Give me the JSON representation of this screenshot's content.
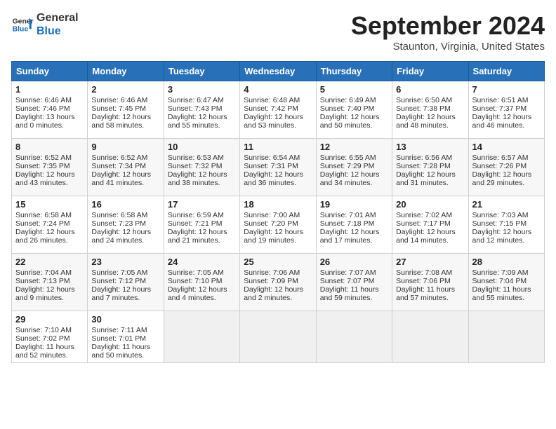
{
  "header": {
    "logo_line1": "General",
    "logo_line2": "Blue",
    "month": "September 2024",
    "location": "Staunton, Virginia, United States"
  },
  "days_of_week": [
    "Sunday",
    "Monday",
    "Tuesday",
    "Wednesday",
    "Thursday",
    "Friday",
    "Saturday"
  ],
  "weeks": [
    [
      {
        "day": "1",
        "sunrise": "Sunrise: 6:46 AM",
        "sunset": "Sunset: 7:46 PM",
        "daylight": "Daylight: 13 hours and 0 minutes."
      },
      {
        "day": "2",
        "sunrise": "Sunrise: 6:46 AM",
        "sunset": "Sunset: 7:45 PM",
        "daylight": "Daylight: 12 hours and 58 minutes."
      },
      {
        "day": "3",
        "sunrise": "Sunrise: 6:47 AM",
        "sunset": "Sunset: 7:43 PM",
        "daylight": "Daylight: 12 hours and 55 minutes."
      },
      {
        "day": "4",
        "sunrise": "Sunrise: 6:48 AM",
        "sunset": "Sunset: 7:42 PM",
        "daylight": "Daylight: 12 hours and 53 minutes."
      },
      {
        "day": "5",
        "sunrise": "Sunrise: 6:49 AM",
        "sunset": "Sunset: 7:40 PM",
        "daylight": "Daylight: 12 hours and 50 minutes."
      },
      {
        "day": "6",
        "sunrise": "Sunrise: 6:50 AM",
        "sunset": "Sunset: 7:38 PM",
        "daylight": "Daylight: 12 hours and 48 minutes."
      },
      {
        "day": "7",
        "sunrise": "Sunrise: 6:51 AM",
        "sunset": "Sunset: 7:37 PM",
        "daylight": "Daylight: 12 hours and 46 minutes."
      }
    ],
    [
      {
        "day": "8",
        "sunrise": "Sunrise: 6:52 AM",
        "sunset": "Sunset: 7:35 PM",
        "daylight": "Daylight: 12 hours and 43 minutes."
      },
      {
        "day": "9",
        "sunrise": "Sunrise: 6:52 AM",
        "sunset": "Sunset: 7:34 PM",
        "daylight": "Daylight: 12 hours and 41 minutes."
      },
      {
        "day": "10",
        "sunrise": "Sunrise: 6:53 AM",
        "sunset": "Sunset: 7:32 PM",
        "daylight": "Daylight: 12 hours and 38 minutes."
      },
      {
        "day": "11",
        "sunrise": "Sunrise: 6:54 AM",
        "sunset": "Sunset: 7:31 PM",
        "daylight": "Daylight: 12 hours and 36 minutes."
      },
      {
        "day": "12",
        "sunrise": "Sunrise: 6:55 AM",
        "sunset": "Sunset: 7:29 PM",
        "daylight": "Daylight: 12 hours and 34 minutes."
      },
      {
        "day": "13",
        "sunrise": "Sunrise: 6:56 AM",
        "sunset": "Sunset: 7:28 PM",
        "daylight": "Daylight: 12 hours and 31 minutes."
      },
      {
        "day": "14",
        "sunrise": "Sunrise: 6:57 AM",
        "sunset": "Sunset: 7:26 PM",
        "daylight": "Daylight: 12 hours and 29 minutes."
      }
    ],
    [
      {
        "day": "15",
        "sunrise": "Sunrise: 6:58 AM",
        "sunset": "Sunset: 7:24 PM",
        "daylight": "Daylight: 12 hours and 26 minutes."
      },
      {
        "day": "16",
        "sunrise": "Sunrise: 6:58 AM",
        "sunset": "Sunset: 7:23 PM",
        "daylight": "Daylight: 12 hours and 24 minutes."
      },
      {
        "day": "17",
        "sunrise": "Sunrise: 6:59 AM",
        "sunset": "Sunset: 7:21 PM",
        "daylight": "Daylight: 12 hours and 21 minutes."
      },
      {
        "day": "18",
        "sunrise": "Sunrise: 7:00 AM",
        "sunset": "Sunset: 7:20 PM",
        "daylight": "Daylight: 12 hours and 19 minutes."
      },
      {
        "day": "19",
        "sunrise": "Sunrise: 7:01 AM",
        "sunset": "Sunset: 7:18 PM",
        "daylight": "Daylight: 12 hours and 17 minutes."
      },
      {
        "day": "20",
        "sunrise": "Sunrise: 7:02 AM",
        "sunset": "Sunset: 7:17 PM",
        "daylight": "Daylight: 12 hours and 14 minutes."
      },
      {
        "day": "21",
        "sunrise": "Sunrise: 7:03 AM",
        "sunset": "Sunset: 7:15 PM",
        "daylight": "Daylight: 12 hours and 12 minutes."
      }
    ],
    [
      {
        "day": "22",
        "sunrise": "Sunrise: 7:04 AM",
        "sunset": "Sunset: 7:13 PM",
        "daylight": "Daylight: 12 hours and 9 minutes."
      },
      {
        "day": "23",
        "sunrise": "Sunrise: 7:05 AM",
        "sunset": "Sunset: 7:12 PM",
        "daylight": "Daylight: 12 hours and 7 minutes."
      },
      {
        "day": "24",
        "sunrise": "Sunrise: 7:05 AM",
        "sunset": "Sunset: 7:10 PM",
        "daylight": "Daylight: 12 hours and 4 minutes."
      },
      {
        "day": "25",
        "sunrise": "Sunrise: 7:06 AM",
        "sunset": "Sunset: 7:09 PM",
        "daylight": "Daylight: 12 hours and 2 minutes."
      },
      {
        "day": "26",
        "sunrise": "Sunrise: 7:07 AM",
        "sunset": "Sunset: 7:07 PM",
        "daylight": "Daylight: 11 hours and 59 minutes."
      },
      {
        "day": "27",
        "sunrise": "Sunrise: 7:08 AM",
        "sunset": "Sunset: 7:06 PM",
        "daylight": "Daylight: 11 hours and 57 minutes."
      },
      {
        "day": "28",
        "sunrise": "Sunrise: 7:09 AM",
        "sunset": "Sunset: 7:04 PM",
        "daylight": "Daylight: 11 hours and 55 minutes."
      }
    ],
    [
      {
        "day": "29",
        "sunrise": "Sunrise: 7:10 AM",
        "sunset": "Sunset: 7:02 PM",
        "daylight": "Daylight: 11 hours and 52 minutes."
      },
      {
        "day": "30",
        "sunrise": "Sunrise: 7:11 AM",
        "sunset": "Sunset: 7:01 PM",
        "daylight": "Daylight: 11 hours and 50 minutes."
      },
      null,
      null,
      null,
      null,
      null
    ]
  ]
}
